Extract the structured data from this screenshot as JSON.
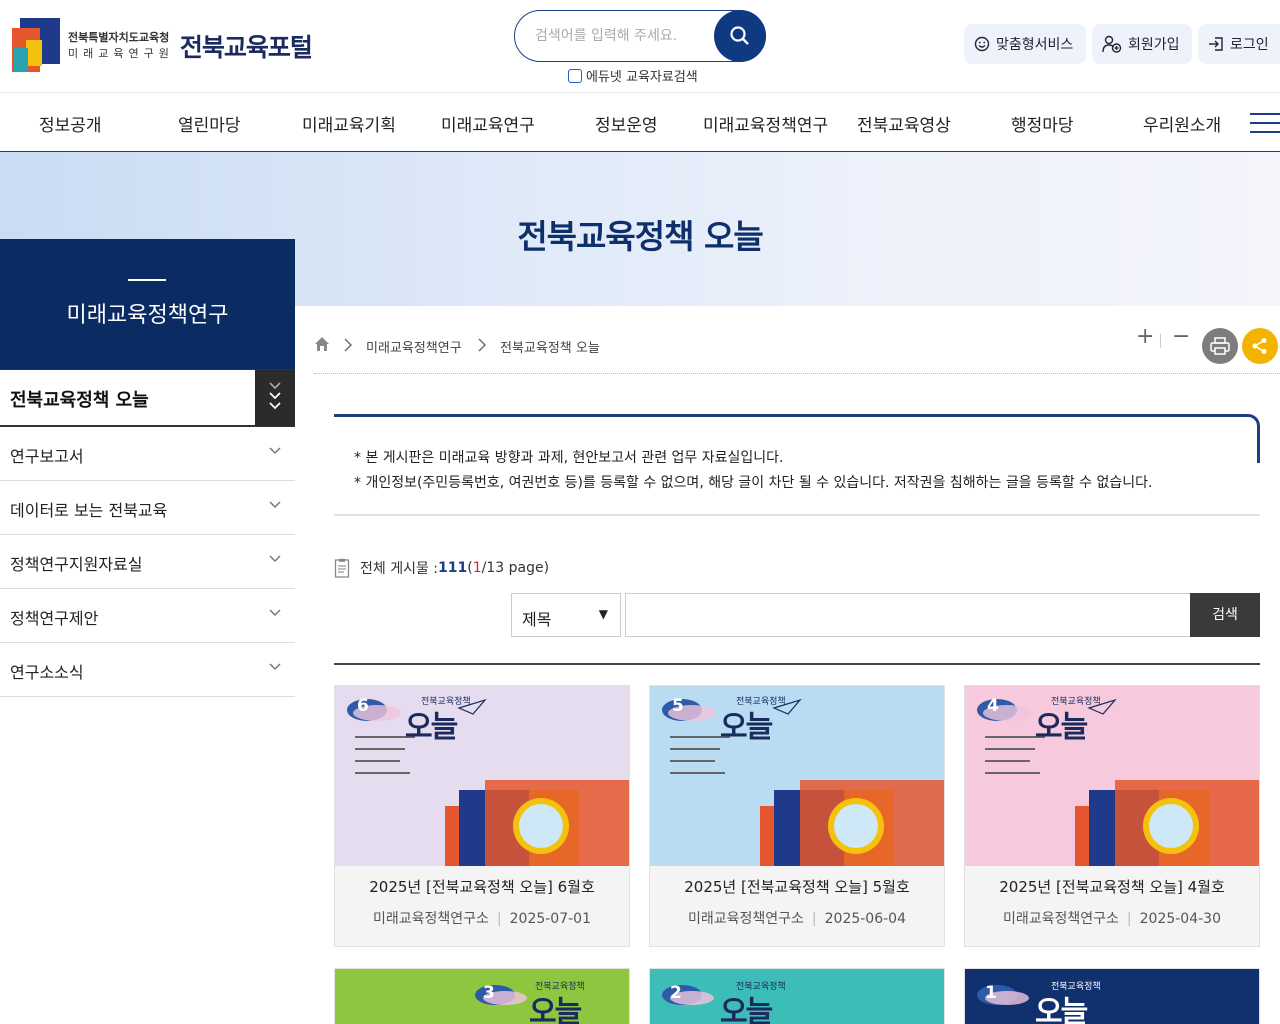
{
  "header": {
    "org_line1": "전북특별자치도교육청",
    "org_line2": "미래교육연구원",
    "portal_name": "전북교육포털",
    "search_placeholder": "검색어를 입력해 주세요.",
    "edunet_label": "에듀넷 교육자료검색",
    "util": {
      "custom_service": "맞춤형서비스",
      "signup": "회원가입",
      "login": "로그인"
    }
  },
  "nav": {
    "items": [
      "정보공개",
      "열린마당",
      "미래교육기획",
      "미래교육연구",
      "정보운영",
      "미래교육정책연구",
      "전북교육영상",
      "행정마당",
      "우리원소개"
    ]
  },
  "banner": {
    "title": "전북교육정책 오늘"
  },
  "sidebar": {
    "title": "미래교육정책연구",
    "active": "전북교육정책 오늘",
    "items": [
      "연구보고서",
      "데이터로 보는 전북교육",
      "정책연구지원자료실",
      "정책연구제안",
      "연구소소식"
    ]
  },
  "breadcrumb": {
    "level1": "미래교육정책연구",
    "level2": "전북교육정책 오늘",
    "zoom_in": "+",
    "zoom_out": "−"
  },
  "notice": {
    "line1": "* 본 게시판은 미래교육 방향과 과제, 현안보고서 관련 업무 자료실입니다.",
    "line2": "* 개인정보(주민등록번호, 여권번호 등)를 등록할 수 없으며, 해당 글이 차단 될 수 있습니다. 저작권을 침해하는 글을 등록할 수 없습니다."
  },
  "board": {
    "total_label": "전체 게시물 :",
    "total": "111",
    "paren_open": "(",
    "current_page": "1",
    "pages_text": "/13 page)",
    "search_field": "제목",
    "search_field_arrow": "▼",
    "search_button": "검색"
  },
  "cards": [
    {
      "title": "2025년 [전북교육정책 오늘] 6월호",
      "author": "미래교육정책연구소",
      "date": "2025-07-01",
      "issue": "6",
      "bg": "#e6dcef",
      "masthead": "전북교육정책",
      "masthead_title": "오늘"
    },
    {
      "title": "2025년 [전북교육정책 오늘] 5월호",
      "author": "미래교육정책연구소",
      "date": "2025-06-04",
      "issue": "5",
      "bg": "#b9dcf3",
      "masthead": "전북교육정책",
      "masthead_title": "오늘"
    },
    {
      "title": "2025년 [전북교육정책 오늘] 4월호",
      "author": "미래교육정책연구소",
      "date": "2025-04-30",
      "issue": "4",
      "bg": "#f6c9dc",
      "masthead": "전북교육정책",
      "masthead_title": "오늘"
    }
  ],
  "cards_row2": [
    {
      "issue": "3",
      "bg": "#8ec63f",
      "masthead": "전북교육정책",
      "masthead_title": "오늘"
    },
    {
      "issue": "2",
      "bg": "#3dbdb7",
      "masthead": "전북교육정책",
      "masthead_title": "오늘"
    },
    {
      "issue": "1",
      "bg": "#10306e",
      "masthead": "전북교육정책",
      "masthead_title": "오늘"
    }
  ],
  "colors": {
    "primary": "#0b2b63",
    "accent": "#f4b300"
  }
}
